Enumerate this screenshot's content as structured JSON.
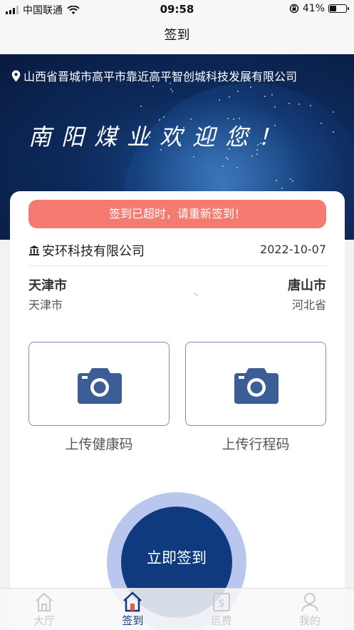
{
  "status_bar": {
    "carrier": "中国联通",
    "time": "09:58",
    "battery_percent": "41%",
    "battery_level": 0.41
  },
  "nav": {
    "title": "签到"
  },
  "banner": {
    "address": "山西省晋城市高平市靠近高平智创城科技发展有限公司",
    "welcome": "南阳煤业欢迎您！"
  },
  "alert": {
    "text": "签到已超时，请重新签到！",
    "color": "#f47a72"
  },
  "order": {
    "company": "安环科技有限公司",
    "date": "2022-10-07",
    "from": {
      "city": "天津市",
      "province": "天津市"
    },
    "to": {
      "city": "唐山市",
      "province": "河北省"
    }
  },
  "uploads": {
    "health_code_label": "上传健康码",
    "trip_code_label": "上传行程码",
    "icon": "camera-icon"
  },
  "checkin": {
    "button_label": "立即签到",
    "color": "#0f3a7d"
  },
  "tabs": [
    {
      "label": "大厅",
      "icon": "home-icon",
      "active": false
    },
    {
      "label": "签到",
      "icon": "checkin-home-icon",
      "active": true
    },
    {
      "label": "运费",
      "icon": "freight-icon",
      "active": false
    },
    {
      "label": "我的",
      "icon": "profile-icon",
      "active": false
    }
  ]
}
